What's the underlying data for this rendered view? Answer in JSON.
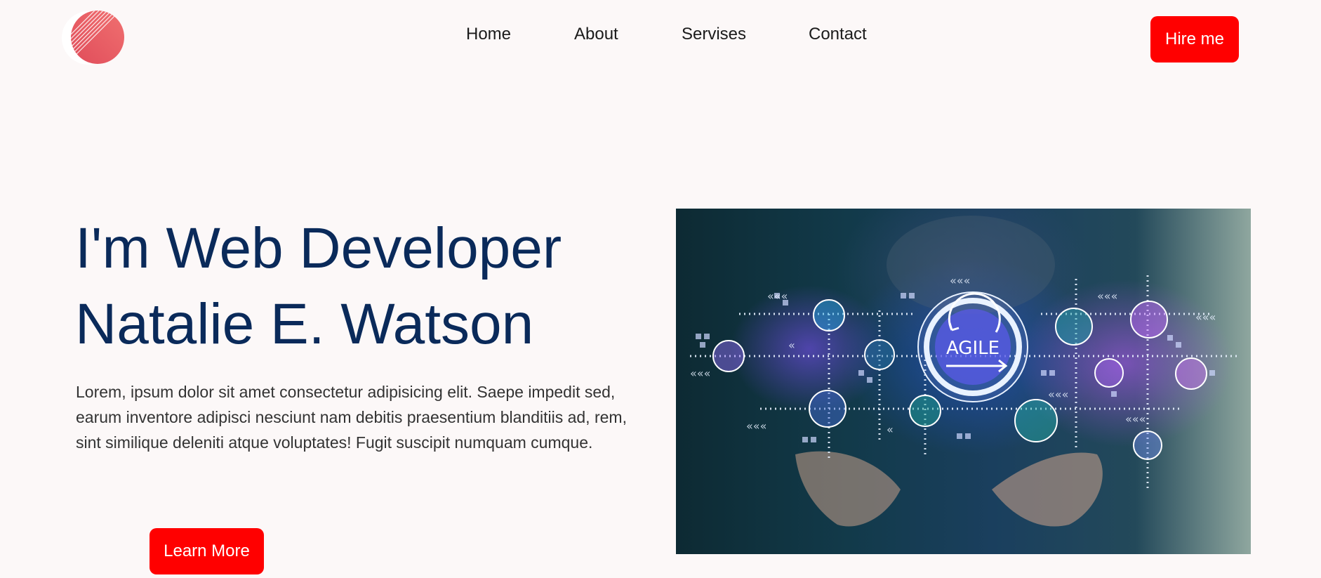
{
  "header": {
    "nav": [
      {
        "label": "Home"
      },
      {
        "label": "About"
      },
      {
        "label": "Servises"
      },
      {
        "label": "Contact"
      }
    ],
    "hire_button": "Hire me"
  },
  "hero": {
    "title_line1": "I'm Web Developer",
    "title_line2": "Natalie E. Watson",
    "description": "Lorem, ipsum dolor sit amet consectetur adipisicing elit. Saepe impedit sed, earum inventore adipisci nesciunt nam debitis praesentium blanditiis ad, rem, sint similique deleniti atque voluptates! Fugit suscipit numquam cumque.",
    "learn_more_button": "Learn More",
    "image_center_label": "AGILE"
  },
  "colors": {
    "accent": "#ff0000",
    "heading": "#0a2a5a",
    "background": "#fcf8f8"
  },
  "icons": [
    "logo-icon",
    "agile-cycle-icon",
    "network-node-icons"
  ]
}
